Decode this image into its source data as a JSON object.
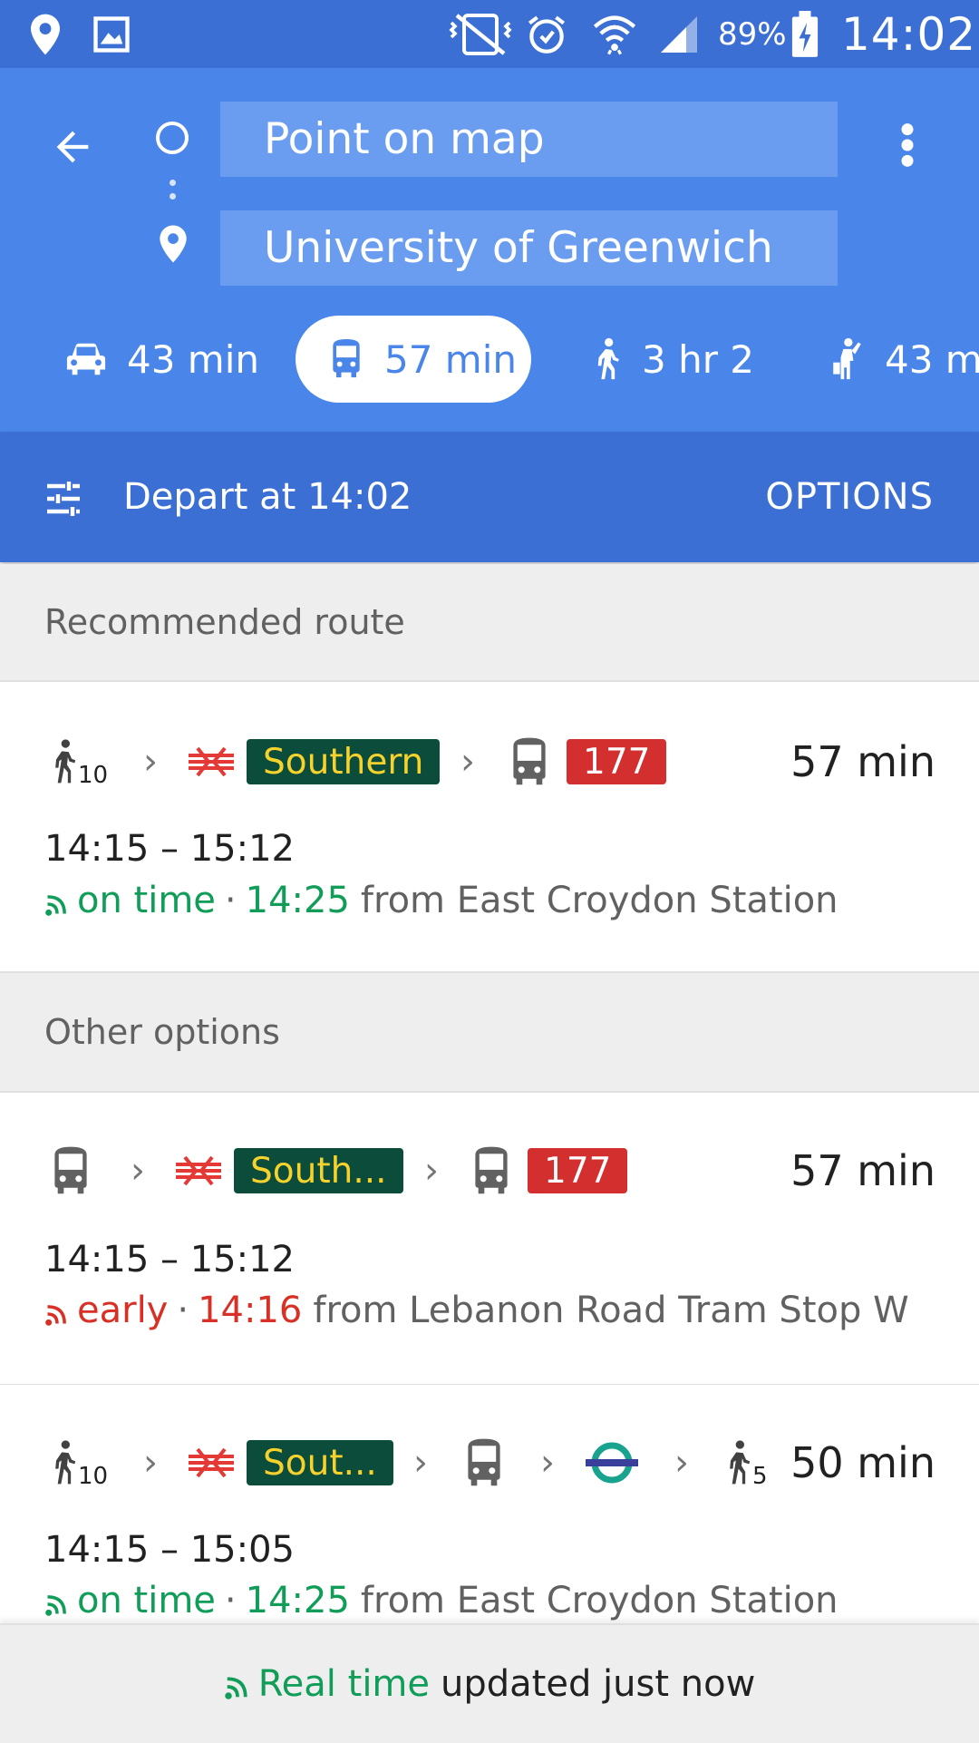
{
  "status_bar": {
    "battery_percent": "89%",
    "time": "14:02",
    "icons": [
      "location-icon",
      "image-icon",
      "vibrate-off-icon",
      "alarm-icon",
      "wifi-icon",
      "signal-icon",
      "battery-charging-icon"
    ]
  },
  "search": {
    "origin": "Point on map",
    "destination": "University of Greenwich"
  },
  "modes": [
    {
      "icon": "car-icon",
      "label": "43 min"
    },
    {
      "icon": "transit-icon",
      "label": "57 min",
      "selected": true
    },
    {
      "icon": "walk-icon",
      "label": "3 hr 2"
    },
    {
      "icon": "ride-hail-icon",
      "label": "43 mi"
    }
  ],
  "depart": {
    "label": "Depart at 14:02",
    "options": "OPTIONS"
  },
  "sections": {
    "recommended": "Recommended route",
    "other": "Other options"
  },
  "routes": [
    {
      "walk_start": "10",
      "train_label": "Southern",
      "bus_number": "177",
      "duration": "57 min",
      "times": "14:15 – 15:12",
      "status": "on time",
      "status_sep": "·",
      "status_time": "14:25",
      "from": "from East Croydon Station"
    },
    {
      "train_label": "South...",
      "bus_number": "177",
      "duration": "57 min",
      "times": "14:15 – 15:12",
      "status": "early",
      "status_sep": "·",
      "status_time": "14:16",
      "from": "from Lebanon Road Tram Stop W"
    },
    {
      "walk_start": "10",
      "train_label": "Sout...",
      "walk_end": "5",
      "duration": "50 min",
      "times": "14:15 – 15:05",
      "status": "on time",
      "status_sep": "·",
      "status_time": "14:25",
      "from": "from East Croydon Station"
    }
  ],
  "footer": {
    "realtime": "Real time",
    "updated": "updated just now"
  },
  "colors": {
    "header_blue": "#4a86ea",
    "dark_blue": "#3b6fd4",
    "southern_green": "#0b4d3a",
    "southern_yellow": "#f7d22c",
    "bus_red": "#d32f2f",
    "ontime_green": "#0f9d58",
    "early_red": "#d93025"
  }
}
